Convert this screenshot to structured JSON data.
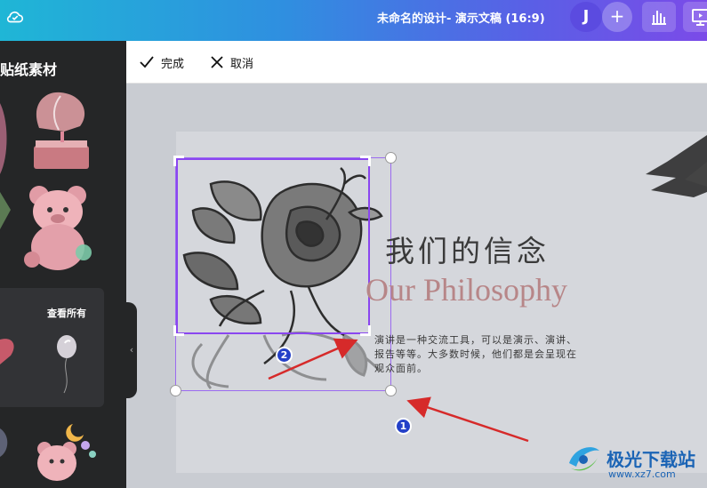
{
  "topbar": {
    "title": "未命名的设计- 演示文稿 (16:9)",
    "avatar_initial": "J",
    "add_label": "+",
    "icons": [
      "cloud-icon",
      "bar-chart-icon",
      "present-icon"
    ]
  },
  "sidepanel": {
    "heading": "贴纸素材",
    "see_all": "查看所有",
    "collapse_glyph": "‹"
  },
  "croptoolbar": {
    "done_label": "完成",
    "cancel_label": "取消"
  },
  "slide": {
    "heading": "我们的信念",
    "subheading": "Our Philosophy",
    "body": "演讲是一种交流工具，可以是演示、演讲、报告等等。大多数时候，他们都是会呈现在观众面前。"
  },
  "annotations": {
    "badge_1": "1",
    "badge_2": "2"
  },
  "watermark": {
    "name": "极光下载站",
    "url": "www.xz7.com"
  },
  "colors": {
    "accent": "#8a46f0",
    "arrow": "#d62a2a",
    "badge": "#2440c8",
    "subheading": "#b78688"
  }
}
